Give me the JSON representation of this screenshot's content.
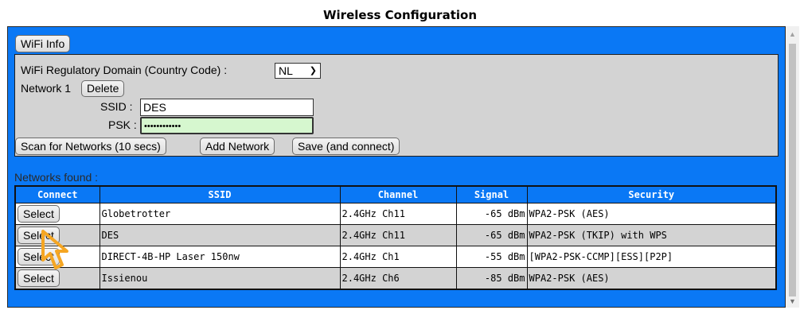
{
  "title": "Wireless Configuration",
  "wifi_info_label": "WiFi Info",
  "domain": {
    "label": "WiFi Regulatory Domain (Country Code) :",
    "value": "NL"
  },
  "network": {
    "label": "Network 1",
    "delete_label": "Delete",
    "ssid_label": "SSID :",
    "ssid_value": "DES",
    "psk_label": "PSK :",
    "psk_value": "••••••••••••"
  },
  "actions": {
    "scan_label": "Scan for Networks (10 secs)",
    "add_label": "Add Network",
    "save_label": "Save (and connect)"
  },
  "networks_found_label": "Networks found :",
  "table": {
    "headers": [
      "Connect",
      "SSID",
      "Channel",
      "Signal",
      "Security"
    ],
    "rows": [
      {
        "select": "Select",
        "ssid": "Globetrotter",
        "channel": "2.4GHz Ch11",
        "signal": "-65 dBm",
        "security": "WPA2-PSK (AES)"
      },
      {
        "select": "Select",
        "ssid": "DES",
        "channel": "2.4GHz Ch11",
        "signal": "-65 dBm",
        "security": "WPA2-PSK (TKIP) with WPS"
      },
      {
        "select": "Select",
        "ssid": "DIRECT-4B-HP Laser 150nw",
        "channel": "2.4GHz Ch1",
        "signal": "-55 dBm",
        "security": "[WPA2-PSK-CCMP][ESS][P2P]"
      },
      {
        "select": "Select",
        "ssid": "Issienou",
        "channel": "2.4GHz Ch6",
        "signal": "-85 dBm",
        "security": "WPA2-PSK (AES)"
      }
    ]
  },
  "colors": {
    "frame_bg": "#0a78f5",
    "panel_bg": "#d3d3d3",
    "psk_bg": "#d6f7cf",
    "cursor": "#f5a623"
  },
  "icons": {
    "cursor": "pointer-arrow-icon",
    "scroll_up": "scroll-up-icon",
    "scroll_down": "scroll-down-icon",
    "select_chevron": "chevron-down-icon"
  }
}
